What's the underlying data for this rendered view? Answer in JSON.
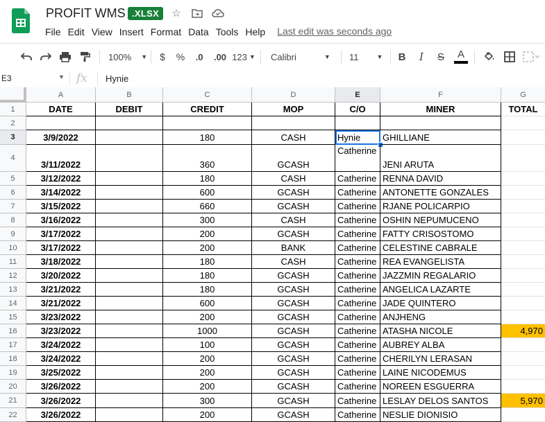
{
  "document": {
    "title": "PROFIT WMS",
    "badge": ".XLSX",
    "last_edit": "Last edit was seconds ago"
  },
  "menu": [
    "File",
    "Edit",
    "View",
    "Insert",
    "Format",
    "Data",
    "Tools",
    "Help"
  ],
  "toolbar": {
    "zoom": "100%",
    "currency": "$",
    "percent": "%",
    "dec_decrease": ".0",
    "dec_increase": ".00",
    "more_formats": "123",
    "font": "Calibri",
    "font_size": "11",
    "bold": "B",
    "italic": "I",
    "strike": "S",
    "text_color": "A"
  },
  "formula_bar": {
    "cell_ref": "E3",
    "fx": "fx",
    "value": "Hynie"
  },
  "columns": [
    "A",
    "B",
    "C",
    "D",
    "E",
    "F",
    "G"
  ],
  "header_row": [
    "DATE",
    "DEBIT",
    "CREDIT",
    "MOP",
    "C/O",
    "MINER",
    "TOTAL"
  ],
  "rows": [
    {
      "num": "1"
    },
    {
      "num": "2",
      "date": "",
      "debit": "",
      "credit": "",
      "mop": "",
      "co": "",
      "miner": "",
      "total": ""
    },
    {
      "num": "3",
      "date": "3/9/2022",
      "debit": "",
      "credit": "180",
      "mop": "CASH",
      "co": "Hynie",
      "miner": "GHILLIANE",
      "total": ""
    },
    {
      "num": "4",
      "date": "3/11/2022",
      "debit": "",
      "credit": "360",
      "mop": "GCASH",
      "co": "Catherine",
      "miner": "JENI ARUTA",
      "total": ""
    },
    {
      "num": "5",
      "date": "3/12/2022",
      "debit": "",
      "credit": "180",
      "mop": "CASH",
      "co": "Catherine",
      "miner": "RENNA DAVID",
      "total": ""
    },
    {
      "num": "6",
      "date": "3/14/2022",
      "debit": "",
      "credit": "600",
      "mop": "GCASH",
      "co": "Catherine",
      "miner": "ANTONETTE GONZALES",
      "total": ""
    },
    {
      "num": "7",
      "date": "3/15/2022",
      "debit": "",
      "credit": "660",
      "mop": "GCASH",
      "co": "Catherine",
      "miner": "RJANE POLICARPIO",
      "total": ""
    },
    {
      "num": "8",
      "date": "3/16/2022",
      "debit": "",
      "credit": "300",
      "mop": "CASH",
      "co": "Catherine",
      "miner": "OSHIN NEPUMUCENO",
      "total": ""
    },
    {
      "num": "9",
      "date": "3/17/2022",
      "debit": "",
      "credit": "200",
      "mop": "GCASH",
      "co": "Catherine",
      "miner": "FATTY CRISOSTOMO",
      "total": ""
    },
    {
      "num": "10",
      "date": "3/17/2022",
      "debit": "",
      "credit": "200",
      "mop": "BANK",
      "co": "Catherine",
      "miner": "CELESTINE CABRALE",
      "total": ""
    },
    {
      "num": "11",
      "date": "3/18/2022",
      "debit": "",
      "credit": "180",
      "mop": "CASH",
      "co": "Catherine",
      "miner": "REA EVANGELISTA",
      "total": ""
    },
    {
      "num": "12",
      "date": "3/20/2022",
      "debit": "",
      "credit": "180",
      "mop": "GCASH",
      "co": "Catherine",
      "miner": "JAZZMIN REGALARIO",
      "total": ""
    },
    {
      "num": "13",
      "date": "3/21/2022",
      "debit": "",
      "credit": "180",
      "mop": "GCASH",
      "co": "Catherine",
      "miner": "ANGELICA LAZARTE",
      "total": ""
    },
    {
      "num": "14",
      "date": "3/21/2022",
      "debit": "",
      "credit": "600",
      "mop": "GCASH",
      "co": "Catherine",
      "miner": "JADE QUINTERO",
      "total": ""
    },
    {
      "num": "15",
      "date": "3/23/2022",
      "debit": "",
      "credit": "200",
      "mop": "GCASH",
      "co": "Catherine",
      "miner": "ANJHENG",
      "total": ""
    },
    {
      "num": "16",
      "date": "3/23/2022",
      "debit": "",
      "credit": "1000",
      "mop": "GCASH",
      "co": "Catherine",
      "miner": "ATASHA NICOLE",
      "total": "4,970"
    },
    {
      "num": "17",
      "date": "3/24/2022",
      "debit": "",
      "credit": "100",
      "mop": "GCASH",
      "co": "Catherine",
      "miner": "AUBREY ALBA",
      "total": ""
    },
    {
      "num": "18",
      "date": "3/24/2022",
      "debit": "",
      "credit": "200",
      "mop": "GCASH",
      "co": "Catherine",
      "miner": "CHERILYN LERASAN",
      "total": ""
    },
    {
      "num": "19",
      "date": "3/25/2022",
      "debit": "",
      "credit": "200",
      "mop": "GCASH",
      "co": "Catherine",
      "miner": "LAINE NICODEMUS",
      "total": ""
    },
    {
      "num": "20",
      "date": "3/26/2022",
      "debit": "",
      "credit": "200",
      "mop": "GCASH",
      "co": "Catherine",
      "miner": "NOREEN ESGUERRA",
      "total": ""
    },
    {
      "num": "21",
      "date": "3/26/2022",
      "debit": "",
      "credit": "300",
      "mop": "GCASH",
      "co": "Catherine",
      "miner": "LESLAY DELOS SANTOS",
      "total": "5,970"
    },
    {
      "num": "22",
      "date": "3/26/2022",
      "debit": "",
      "credit": "200",
      "mop": "GCASH",
      "co": "Catherine",
      "miner": "NESLIE DIONISIO",
      "total": ""
    }
  ],
  "colors": {
    "highlight": "#ffc000",
    "selection": "#1a73e8",
    "brand_green": "#188038"
  }
}
